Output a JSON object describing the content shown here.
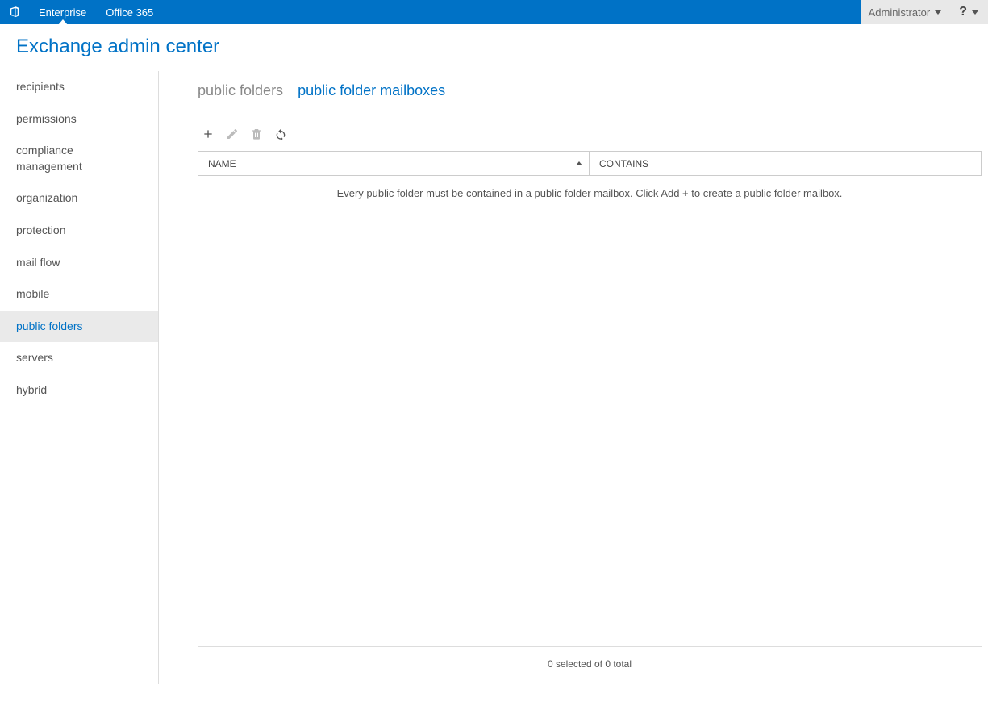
{
  "top_bar": {
    "nav": [
      {
        "label": "Enterprise",
        "active": true
      },
      {
        "label": "Office 365",
        "active": false
      }
    ],
    "user_label": "Administrator",
    "help_symbol": "?"
  },
  "app_title": "Exchange admin center",
  "sidebar": {
    "items": [
      {
        "label": "recipients",
        "active": false
      },
      {
        "label": "permissions",
        "active": false
      },
      {
        "label": "compliance management",
        "active": false
      },
      {
        "label": "organization",
        "active": false
      },
      {
        "label": "protection",
        "active": false
      },
      {
        "label": "mail flow",
        "active": false
      },
      {
        "label": "mobile",
        "active": false
      },
      {
        "label": "public folders",
        "active": true
      },
      {
        "label": "servers",
        "active": false
      },
      {
        "label": "hybrid",
        "active": false
      }
    ]
  },
  "tabs": {
    "items": [
      {
        "label": "public folders",
        "active": false
      },
      {
        "label": "public folder mailboxes",
        "active": true
      }
    ]
  },
  "toolbar": {
    "add_title": "New",
    "edit_title": "Edit",
    "delete_title": "Delete",
    "refresh_title": "Refresh"
  },
  "table": {
    "columns": {
      "name": "NAME",
      "contains": "CONTAINS"
    },
    "empty_message": "Every public folder must be contained in a public folder mailbox. Click Add + to create a public folder mailbox."
  },
  "footer": {
    "status": "0 selected of 0 total"
  }
}
